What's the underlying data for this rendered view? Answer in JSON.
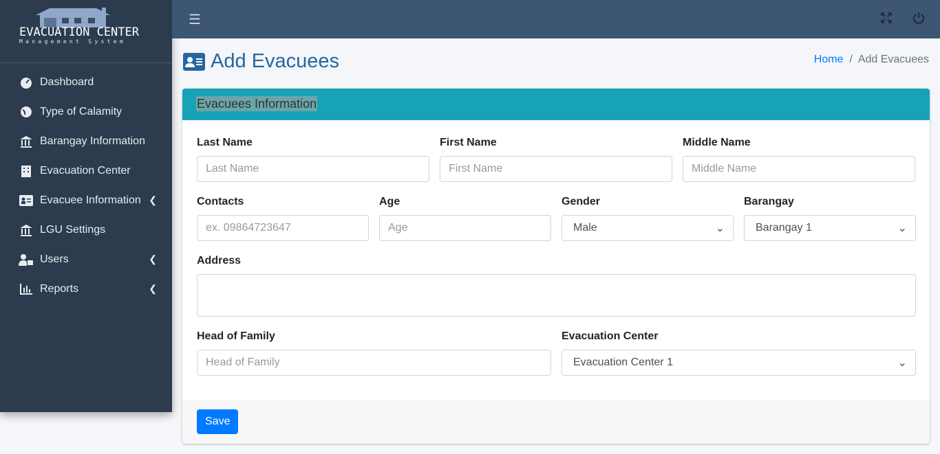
{
  "brand": {
    "title": "EVACUATION CENTER",
    "subtitle": "Management System"
  },
  "sidebar": {
    "items": [
      {
        "label": "Dashboard",
        "icon": "tachometer-icon"
      },
      {
        "label": "Type of Calamity",
        "icon": "globe-icon"
      },
      {
        "label": "Barangay Information",
        "icon": "university-icon"
      },
      {
        "label": "Evacuation Center",
        "icon": "building-icon"
      },
      {
        "label": "Evacuee Information",
        "icon": "id-card-icon",
        "has_children": true
      },
      {
        "label": "LGU Settings",
        "icon": "landmark-icon"
      },
      {
        "label": "Users",
        "icon": "users-lock-icon",
        "has_children": true
      },
      {
        "label": "Reports",
        "icon": "chart-bar-icon",
        "has_children": true
      }
    ]
  },
  "header": {
    "menu_icon": "☰"
  },
  "page": {
    "title": "Add Evacuees",
    "breadcrumb": {
      "home": "Home",
      "sep": "/",
      "current": "Add Evacuees"
    }
  },
  "form": {
    "header": "Evacuees Information",
    "last_name": {
      "label": "Last Name",
      "placeholder": "Last Name"
    },
    "first_name": {
      "label": "First Name",
      "placeholder": "First Name"
    },
    "middle_name": {
      "label": "Middle Name",
      "placeholder": "Middle Name"
    },
    "contacts": {
      "label": "Contacts",
      "placeholder": "ex. 09864723647"
    },
    "age": {
      "label": "Age",
      "placeholder": "Age"
    },
    "gender": {
      "label": "Gender",
      "value": "Male"
    },
    "barangay": {
      "label": "Barangay",
      "value": "Barangay 1"
    },
    "address": {
      "label": "Address",
      "value": ""
    },
    "head": {
      "label": "Head of Family",
      "placeholder": "Head of Family"
    },
    "center": {
      "label": "Evacuation Center",
      "value": "Evacuation Center 1"
    },
    "save": "Save"
  }
}
